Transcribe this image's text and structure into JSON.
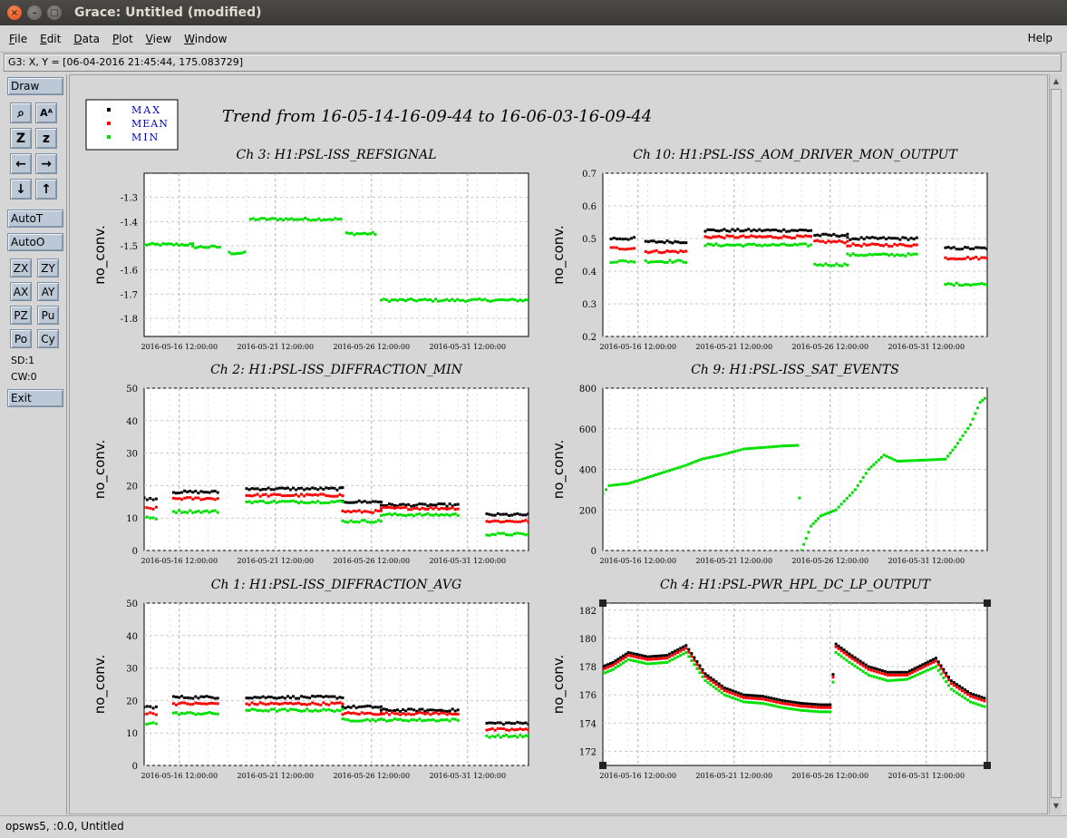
{
  "window": {
    "title": "Grace: Untitled (modified)"
  },
  "menubar": {
    "items": [
      {
        "label": "File",
        "u": "F",
        "rest": "ile"
      },
      {
        "label": "Edit",
        "u": "E",
        "rest": "dit"
      },
      {
        "label": "Data",
        "u": "D",
        "rest": "ata"
      },
      {
        "label": "Plot",
        "u": "P",
        "rest": "lot"
      },
      {
        "label": "View",
        "u": "V",
        "rest": "iew"
      },
      {
        "label": "Window",
        "u": "W",
        "rest": "indow"
      }
    ],
    "help": "Help"
  },
  "locator": "G3: X, Y = [06-04-2016 21:45:44, 175.083729]",
  "toolbar": {
    "draw": "Draw",
    "autot": "AutoT",
    "autoo": "AutoO",
    "zx": "ZX",
    "zy": "ZY",
    "ax": "AX",
    "ay": "AY",
    "pz": "PZ",
    "pu": "Pu",
    "po": "Po",
    "cy": "Cy",
    "sd": "SD:1",
    "cw": "CW:0",
    "exit": "Exit",
    "icons": {
      "zoom": "⌕",
      "text": "Aᴬ",
      "zoom_in": "Z",
      "zoom_out": "z",
      "left": "←",
      "right": "→",
      "down": "↓",
      "up": "↑"
    }
  },
  "statusbar": "opsws5, :0.0, Untitled",
  "figure": {
    "main_title": "Trend from 16-05-14-16-09-44 to 16-06-03-16-09-44",
    "legend": [
      {
        "label": "MAX",
        "color": "#000000"
      },
      {
        "label": "MEAN",
        "color": "#ff0000"
      },
      {
        "label": "MIN",
        "color": "#00e000"
      }
    ],
    "legend_text_color": "#0000c0"
  },
  "chart_data": [
    {
      "type": "scatter",
      "title": "Ch 3: H1:PSL-ISS_REFSIGNAL",
      "ylabel": "no_conv.",
      "xlabel": "",
      "x_ticks": [
        "2016-05-16 12:00:00",
        "2016-05-21 12:00:00",
        "2016-05-26 12:00:00",
        "2016-05-31 12:00:00"
      ],
      "x_range_days": [
        14.67,
        34.67
      ],
      "ylim": [
        -1.875,
        -1.2
      ],
      "yticks": [
        -1.8,
        -1.7,
        -1.6,
        -1.5,
        -1.4,
        -1.3
      ],
      "series": [
        {
          "name": "MIN",
          "segments": [
            [
              14.67,
              17.2,
              -1.495
            ],
            [
              17.2,
              18.6,
              -1.505
            ],
            [
              19.1,
              19.9,
              -1.53
            ],
            [
              20.2,
              24.9,
              -1.39
            ],
            [
              25.2,
              26.7,
              -1.45
            ],
            [
              27.0,
              34.67,
              -1.725
            ]
          ]
        }
      ]
    },
    {
      "type": "scatter",
      "title": "Ch 10: H1:PSL-ISS_AOM_DRIVER_MON_OUTPUT",
      "ylabel": "no_conv.",
      "xlabel": "",
      "x_ticks": [
        "2016-05-16 12:00:00",
        "2016-05-21 12:00:00",
        "2016-05-26 12:00:00",
        "2016-05-31 12:00:00"
      ],
      "x_range_days": [
        14.67,
        34.67
      ],
      "ylim": [
        0.2,
        0.7
      ],
      "yticks": [
        0.2,
        0.3,
        0.4,
        0.5,
        0.6,
        0.7
      ],
      "series": [
        {
          "name": "MAX",
          "segments": [
            [
              15.1,
              16.3,
              0.5
            ],
            [
              16.9,
              19.0,
              0.49
            ],
            [
              20.0,
              25.5,
              0.525
            ],
            [
              25.7,
              27.4,
              0.51
            ],
            [
              27.4,
              31.0,
              0.5
            ],
            [
              32.5,
              34.67,
              0.47
            ]
          ]
        },
        {
          "name": "MEAN",
          "segments": [
            [
              15.1,
              16.3,
              0.47
            ],
            [
              16.9,
              19.0,
              0.46
            ],
            [
              20.0,
              25.5,
              0.505
            ],
            [
              25.7,
              27.4,
              0.49
            ],
            [
              27.4,
              31.0,
              0.48
            ],
            [
              32.5,
              34.67,
              0.44
            ]
          ]
        },
        {
          "name": "MIN",
          "segments": [
            [
              15.1,
              16.3,
              0.43
            ],
            [
              16.9,
              19.0,
              0.43
            ],
            [
              20.0,
              25.5,
              0.48
            ],
            [
              25.7,
              27.4,
              0.42
            ],
            [
              27.4,
              31.0,
              0.45
            ],
            [
              32.5,
              34.67,
              0.36
            ]
          ]
        }
      ]
    },
    {
      "type": "scatter",
      "title": "Ch 2: H1:PSL-ISS_DIFFRACTION_MIN",
      "ylabel": "no_conv.",
      "xlabel": "",
      "x_ticks": [
        "2016-05-16 12:00:00",
        "2016-05-21 12:00:00",
        "2016-05-26 12:00:00",
        "2016-05-31 12:00:00"
      ],
      "x_range_days": [
        14.67,
        34.67
      ],
      "ylim": [
        0,
        50
      ],
      "yticks": [
        0,
        10,
        20,
        30,
        40,
        50
      ],
      "series": [
        {
          "name": "MAX",
          "segments": [
            [
              14.67,
              15.3,
              16
            ],
            [
              16.2,
              18.5,
              18
            ],
            [
              20.0,
              25.0,
              19
            ],
            [
              25.0,
              27.0,
              15
            ],
            [
              27.0,
              31.0,
              14
            ],
            [
              32.5,
              34.67,
              11
            ]
          ]
        },
        {
          "name": "MEAN",
          "segments": [
            [
              14.67,
              15.3,
              13
            ],
            [
              16.2,
              18.5,
              16
            ],
            [
              20.0,
              25.0,
              17
            ],
            [
              25.0,
              27.0,
              12
            ],
            [
              27.0,
              31.0,
              13
            ],
            [
              32.5,
              34.67,
              9
            ]
          ]
        },
        {
          "name": "MIN",
          "segments": [
            [
              14.67,
              15.3,
              10
            ],
            [
              16.2,
              18.5,
              12
            ],
            [
              20.0,
              25.0,
              15
            ],
            [
              25.0,
              27.0,
              9
            ],
            [
              27.0,
              31.0,
              11
            ],
            [
              32.5,
              34.67,
              5
            ]
          ]
        }
      ]
    },
    {
      "type": "scatter",
      "title": "Ch 9: H1:PSL-ISS_SAT_EVENTS",
      "ylabel": "no_conv.",
      "xlabel": "",
      "x_ticks": [
        "2016-05-16 12:00:00",
        "2016-05-21 12:00:00",
        "2016-05-26 12:00:00",
        "2016-05-31 12:00:00"
      ],
      "x_range_days": [
        14.67,
        34.67
      ],
      "ylim": [
        0,
        800
      ],
      "yticks": [
        0,
        200,
        400,
        600,
        800
      ],
      "series": [
        {
          "name": "MIN",
          "points": [
            [
              14.67,
              280
            ],
            [
              15.0,
              320
            ],
            [
              16.0,
              330
            ],
            [
              17.0,
              360
            ],
            [
              18.0,
              390
            ],
            [
              19.0,
              420
            ],
            [
              19.8,
              450
            ],
            [
              20.8,
              470
            ],
            [
              22.0,
              500
            ],
            [
              24.0,
              515
            ],
            [
              24.8,
              518
            ],
            [
              25.0,
              0
            ],
            [
              25.5,
              120
            ],
            [
              26.0,
              170
            ],
            [
              26.8,
              200
            ],
            [
              27.8,
              300
            ],
            [
              28.5,
              400
            ],
            [
              29.3,
              470
            ],
            [
              30.0,
              440
            ],
            [
              32.5,
              450
            ],
            [
              33.0,
              510
            ],
            [
              33.8,
              620
            ],
            [
              34.3,
              730
            ],
            [
              34.67,
              760
            ]
          ]
        }
      ]
    },
    {
      "type": "scatter",
      "title": "Ch 1: H1:PSL-ISS_DIFFRACTION_AVG",
      "ylabel": "no_conv.",
      "xlabel": "",
      "x_ticks": [
        "2016-05-16 12:00:00",
        "2016-05-21 12:00:00",
        "2016-05-26 12:00:00",
        "2016-05-31 12:00:00"
      ],
      "x_range_days": [
        14.67,
        34.67
      ],
      "ylim": [
        0,
        50
      ],
      "yticks": [
        0,
        10,
        20,
        30,
        40,
        50
      ],
      "series": [
        {
          "name": "MAX",
          "segments": [
            [
              14.67,
              15.3,
              18
            ],
            [
              16.2,
              18.5,
              21
            ],
            [
              20.0,
              25.0,
              21
            ],
            [
              25.0,
              27.0,
              18
            ],
            [
              27.0,
              31.0,
              17
            ],
            [
              32.5,
              34.67,
              13
            ]
          ]
        },
        {
          "name": "MEAN",
          "segments": [
            [
              14.67,
              15.3,
              16
            ],
            [
              16.2,
              18.5,
              19
            ],
            [
              20.0,
              25.0,
              19
            ],
            [
              25.0,
              27.0,
              16
            ],
            [
              27.0,
              31.0,
              16
            ],
            [
              32.5,
              34.67,
              11
            ]
          ]
        },
        {
          "name": "MIN",
          "segments": [
            [
              14.67,
              15.3,
              13
            ],
            [
              16.2,
              18.5,
              16
            ],
            [
              20.0,
              25.0,
              17
            ],
            [
              25.0,
              27.0,
              14
            ],
            [
              27.0,
              31.0,
              14
            ],
            [
              32.5,
              34.67,
              9
            ]
          ]
        }
      ]
    },
    {
      "type": "scatter",
      "title": "Ch 4: H1:PSL-PWR_HPL_DC_LP_OUTPUT",
      "ylabel": "no_conv.",
      "xlabel": "",
      "x_ticks": [
        "2016-05-16 12:00:00",
        "2016-05-21 12:00:00",
        "2016-05-26 12:00:00",
        "2016-05-31 12:00:00"
      ],
      "x_range_days": [
        14.67,
        34.67
      ],
      "ylim": [
        171,
        182.5
      ],
      "yticks": [
        172,
        174,
        176,
        178,
        180,
        182
      ],
      "series": [
        {
          "name": "MAX",
          "points": [
            [
              14.67,
              178.0
            ],
            [
              15.2,
              178.3
            ],
            [
              16.0,
              179.0
            ],
            [
              17.0,
              178.7
            ],
            [
              18.0,
              178.8
            ],
            [
              19.0,
              179.5
            ],
            [
              20.0,
              177.5
            ],
            [
              21.0,
              176.5
            ],
            [
              22.0,
              176.0
            ],
            [
              23.0,
              175.9
            ],
            [
              24.0,
              175.6
            ],
            [
              25.0,
              175.4
            ],
            [
              26.0,
              175.3
            ],
            [
              26.5,
              175.3
            ],
            [
              26.8,
              179.6
            ],
            [
              27.5,
              178.9
            ],
            [
              28.5,
              178.0
            ],
            [
              29.5,
              177.6
            ],
            [
              30.5,
              177.6
            ],
            [
              32.0,
              178.6
            ],
            [
              32.8,
              177.0
            ],
            [
              33.8,
              176.1
            ],
            [
              34.67,
              175.7
            ]
          ]
        },
        {
          "name": "MEAN",
          "points": [
            [
              14.67,
              177.8
            ],
            [
              15.2,
              178.1
            ],
            [
              16.0,
              178.8
            ],
            [
              17.0,
              178.5
            ],
            [
              18.0,
              178.6
            ],
            [
              19.0,
              179.3
            ],
            [
              20.0,
              177.3
            ],
            [
              21.0,
              176.3
            ],
            [
              22.0,
              175.8
            ],
            [
              23.0,
              175.7
            ],
            [
              24.0,
              175.4
            ],
            [
              25.0,
              175.2
            ],
            [
              26.0,
              175.1
            ],
            [
              26.5,
              175.1
            ],
            [
              26.8,
              179.4
            ],
            [
              27.5,
              178.7
            ],
            [
              28.5,
              177.8
            ],
            [
              29.5,
              177.4
            ],
            [
              30.5,
              177.4
            ],
            [
              32.0,
              178.4
            ],
            [
              32.8,
              176.8
            ],
            [
              33.8,
              175.9
            ],
            [
              34.67,
              175.5
            ]
          ]
        },
        {
          "name": "MIN",
          "points": [
            [
              14.67,
              177.5
            ],
            [
              15.2,
              177.8
            ],
            [
              16.0,
              178.5
            ],
            [
              17.0,
              178.2
            ],
            [
              18.0,
              178.3
            ],
            [
              19.0,
              179.0
            ],
            [
              20.0,
              177.0
            ],
            [
              21.0,
              176.0
            ],
            [
              22.0,
              175.5
            ],
            [
              23.0,
              175.4
            ],
            [
              24.0,
              175.1
            ],
            [
              25.0,
              174.9
            ],
            [
              26.0,
              174.8
            ],
            [
              26.5,
              174.8
            ],
            [
              26.8,
              179.0
            ],
            [
              27.5,
              178.3
            ],
            [
              28.5,
              177.4
            ],
            [
              29.5,
              177.0
            ],
            [
              30.5,
              177.1
            ],
            [
              32.0,
              178.0
            ],
            [
              32.8,
              176.4
            ],
            [
              33.8,
              175.5
            ],
            [
              34.67,
              175.1
            ]
          ]
        }
      ]
    }
  ]
}
